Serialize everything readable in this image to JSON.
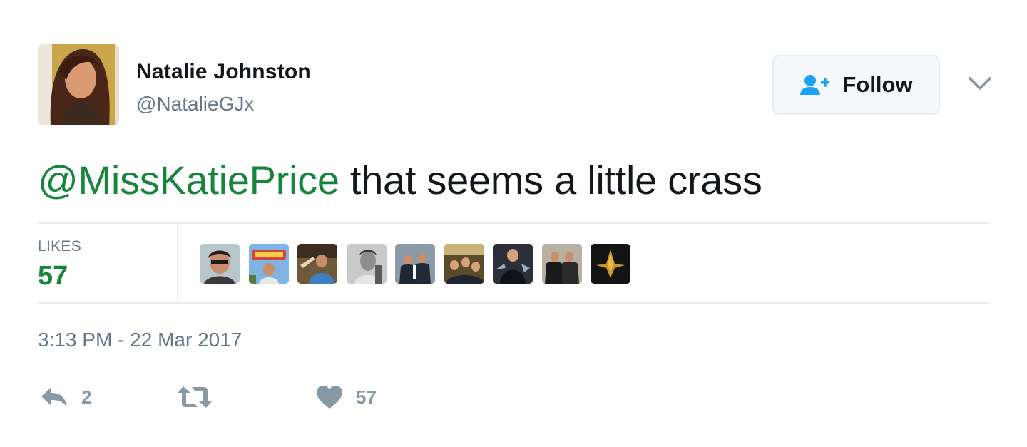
{
  "author": {
    "name": "Natalie Johnston",
    "handle": "@NatalieGJx",
    "avatar_icon": "profile-photo"
  },
  "follow_button": {
    "label": "Follow",
    "icon": "follow-user-icon"
  },
  "menu": {
    "icon": "chevron-down-icon"
  },
  "tweet": {
    "mention": "@MissKatiePrice",
    "text": " that seems a little crass"
  },
  "stats": {
    "likes_label": "LIKES",
    "likes_count": "57",
    "liker_avatars": [
      "liker-1",
      "liker-2",
      "liker-3",
      "liker-4",
      "liker-5",
      "liker-6",
      "liker-7",
      "liker-8",
      "liker-9"
    ]
  },
  "timestamp": "3:13 PM - 22 Mar 2017",
  "actions": {
    "reply_count": "2",
    "retweet_count": "",
    "like_count": "57"
  },
  "colors": {
    "accent_green": "#17853b",
    "muted_text": "#657786",
    "action_grey": "#8899a6",
    "follow_icon_blue": "#1da1f2",
    "divider": "#e6ecf0"
  }
}
